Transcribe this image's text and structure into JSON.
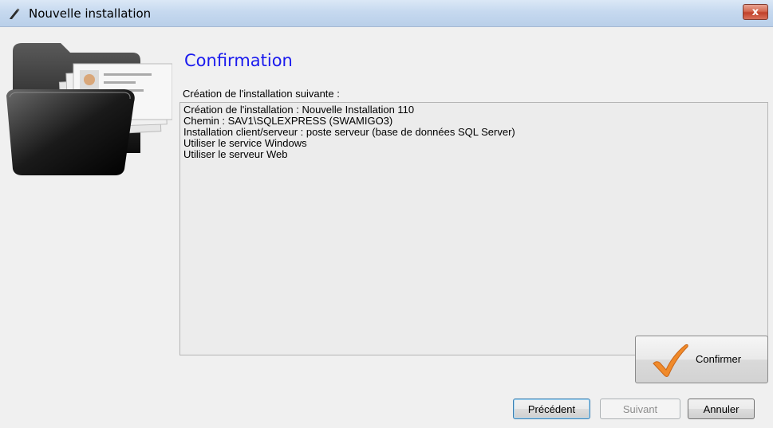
{
  "window": {
    "title": "Nouvelle installation",
    "close_label": "x"
  },
  "page": {
    "heading": "Confirmation",
    "sublabel": "Création de l'installation suivante :",
    "summary_lines": [
      "Création de l'installation : Nouvelle Installation 110",
      "Chemin : SAV1\\SQLEXPRESS (SWAMIGO3)",
      "Installation client/serveur : poste serveur (base de données SQL Server)",
      "Utiliser le service Windows",
      "Utiliser le serveur Web"
    ]
  },
  "buttons": {
    "confirm": "Confirmer",
    "previous": "Précédent",
    "next": "Suivant",
    "cancel": "Annuler"
  },
  "colors": {
    "heading": "#1a1aee",
    "check": "#f08a2a"
  }
}
